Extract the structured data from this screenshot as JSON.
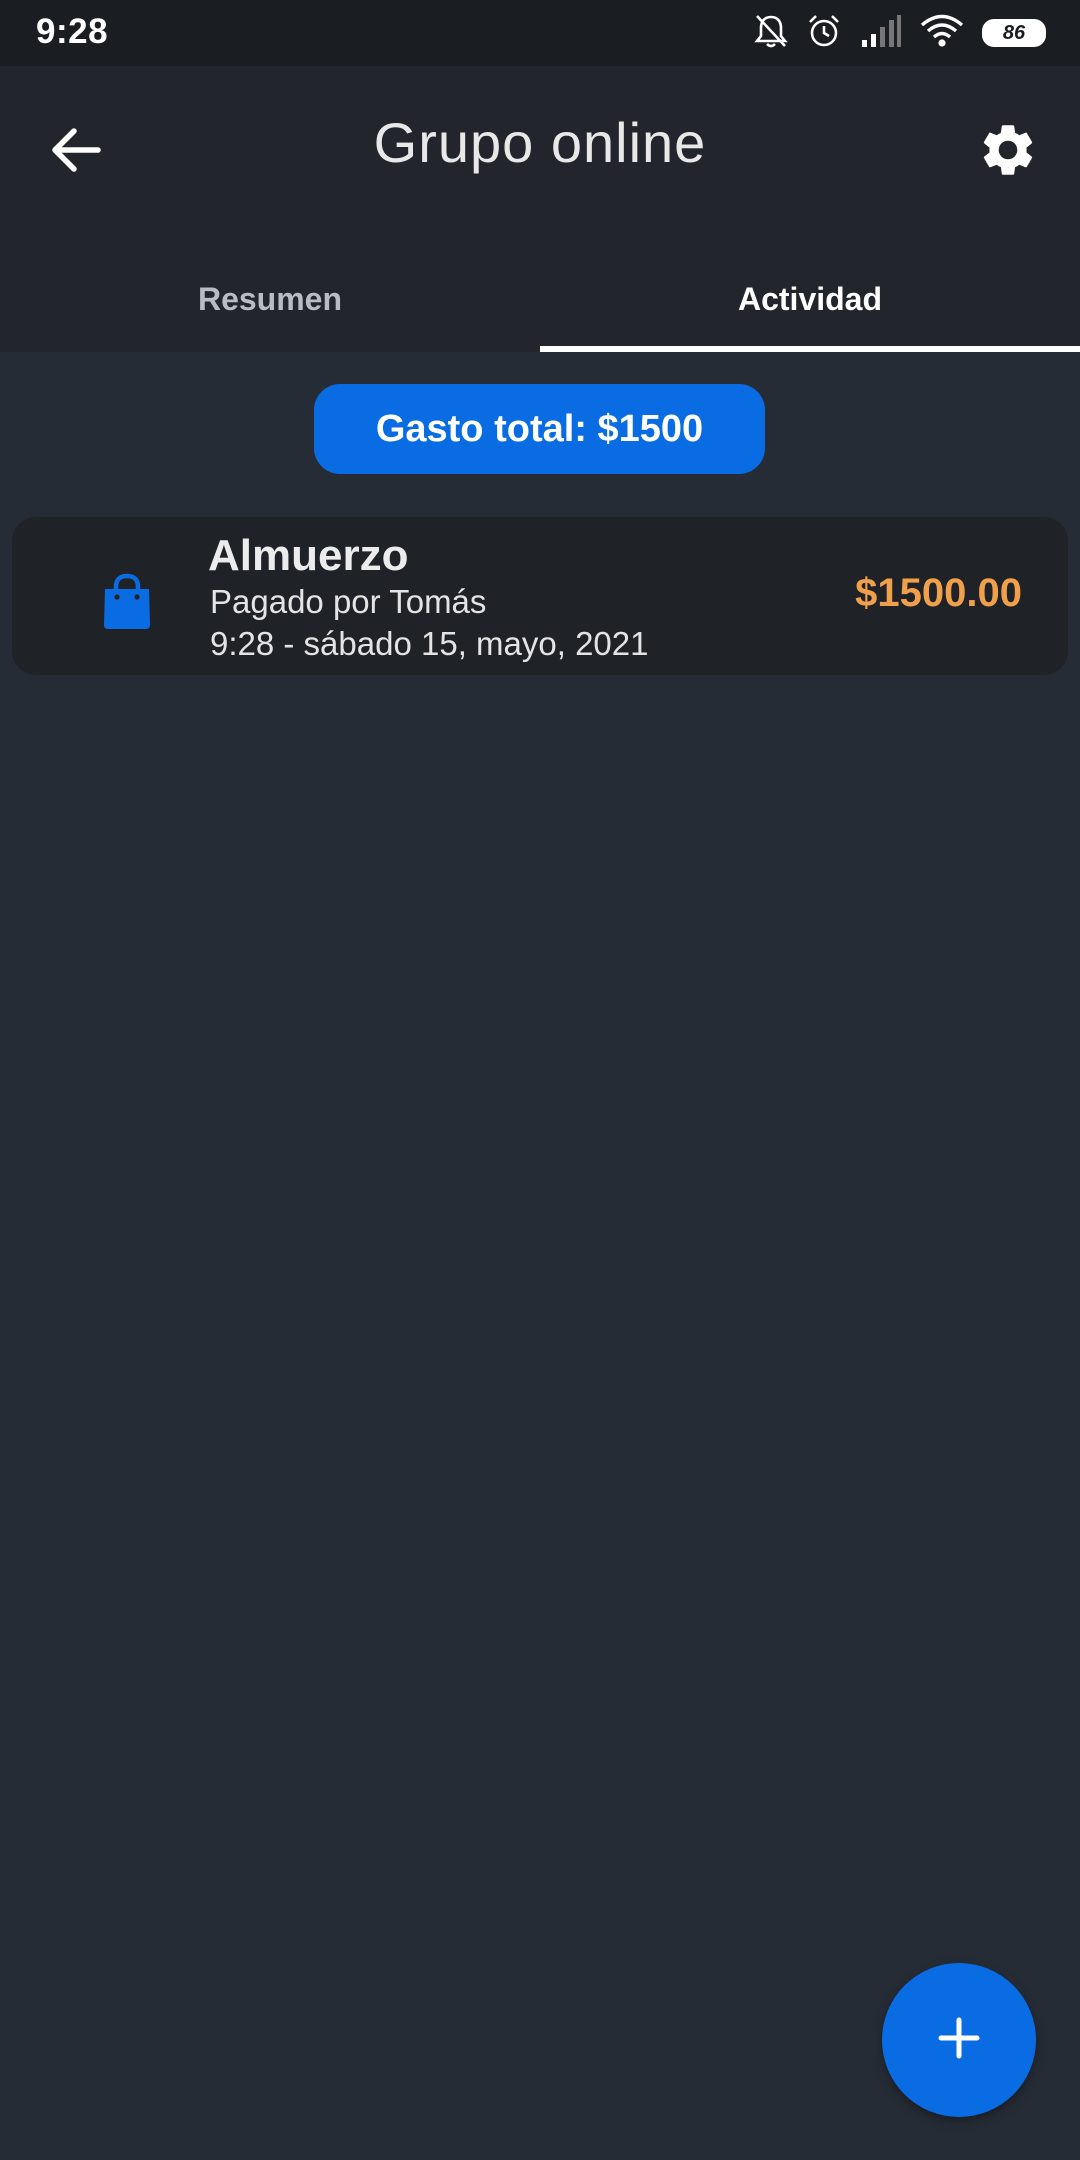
{
  "status_bar": {
    "time": "9:28",
    "battery": "86",
    "icons": [
      "bell-off-icon",
      "alarm-icon",
      "signal-icon",
      "wifi-icon",
      "battery-icon"
    ]
  },
  "header": {
    "title": "Grupo online",
    "back_icon": "arrow-back-icon",
    "settings_icon": "gear-icon"
  },
  "tabs": [
    {
      "label": "Resumen",
      "selected": false
    },
    {
      "label": "Actividad",
      "selected": true
    }
  ],
  "summary": {
    "total_label": "Gasto total: $1500"
  },
  "expenses": [
    {
      "icon": "shopping-bag-icon",
      "title": "Almuerzo",
      "payer": "Pagado por Tomás",
      "datetime": "9:28 - sábado 15, mayo, 2021",
      "amount": "$1500.00"
    }
  ],
  "fab": {
    "icon": "plus-icon"
  },
  "colors": {
    "accent": "#0a6ce2",
    "amount": "#f0a04b",
    "background": "#262c36",
    "header": "#22252b"
  }
}
